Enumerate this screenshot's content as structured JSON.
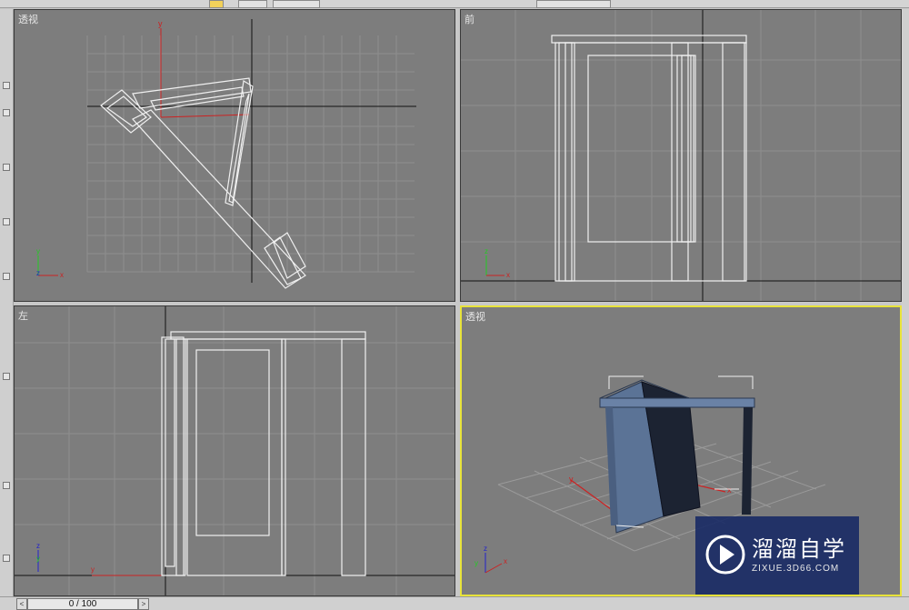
{
  "viewports": {
    "top_left": {
      "label": "透视"
    },
    "top_right": {
      "label": "前"
    },
    "bottom_left": {
      "label": "左"
    },
    "bottom_right": {
      "label": "透视"
    }
  },
  "statusbar": {
    "time_slider": "0 / 100",
    "prev": "<",
    "next": ">"
  },
  "watermark": {
    "name": "溜溜自学",
    "url": "ZIXUE.3D66.COM"
  },
  "colors": {
    "viewport_bg": "#7d7d7d",
    "active_border": "#e8e33a",
    "door_blue": "#5b7396"
  }
}
